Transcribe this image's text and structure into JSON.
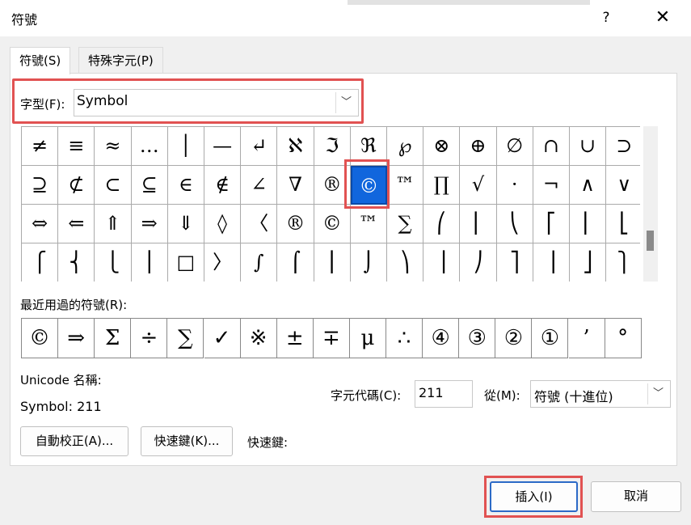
{
  "window": {
    "title": "符號",
    "help": "?",
    "close": "✕"
  },
  "tabs": [
    {
      "label": "符號(S)"
    },
    {
      "label": "特殊字元(P)"
    }
  ],
  "font": {
    "label": "字型(F):",
    "value": "Symbol"
  },
  "grid": {
    "rows": [
      [
        "≠",
        "≡",
        "≈",
        "…",
        "│",
        "—",
        "↵",
        "ℵ",
        "ℑ",
        "ℜ",
        "℘",
        "⊗",
        "⊕",
        "∅",
        "∩",
        "∪",
        "⊃"
      ],
      [
        "⊇",
        "⊄",
        "⊂",
        "⊆",
        "∈",
        "∉",
        "∠",
        "∇",
        "®",
        "©",
        "™",
        "∏",
        "√",
        "·",
        "¬",
        "∧",
        "∨"
      ],
      [
        "⇔",
        "⇐",
        "⇑",
        "⇒",
        "⇓",
        "◊",
        "〈",
        "®",
        "©",
        "™",
        "∑",
        "⎛",
        "⎜",
        "⎝",
        "⎡",
        "⎢",
        "⎣"
      ],
      [
        "⎧",
        "⎨",
        "⎩",
        "⎪",
        "□",
        "〉",
        "∫",
        "⌠",
        "⎮",
        "⌡",
        "⎞",
        "⎟",
        "⎠",
        "⎤",
        "⎥",
        "⎦",
        "⎫"
      ]
    ],
    "selected": {
      "row": 1,
      "col": 9
    }
  },
  "recent": {
    "label": "最近用過的符號(R):",
    "symbols": [
      "©",
      "⇒",
      "Σ",
      "÷",
      "∑",
      "✓",
      "※",
      "±",
      "∓",
      "μ",
      "∴",
      "④",
      "③",
      "②",
      "①",
      "’",
      "°"
    ]
  },
  "unicode": {
    "label": "Unicode 名稱:",
    "value": "Symbol: 211"
  },
  "char_code": {
    "label": "字元代碼(C):",
    "value": "211"
  },
  "from": {
    "label": "從(M):",
    "value": "符號 (十進位)"
  },
  "buttons": {
    "autocorrect": "自動校正(A)...",
    "shortcut_key": "快速鍵(K)...",
    "shortcut_label": "快速鍵:",
    "insert": "插入(I)",
    "cancel": "取消"
  }
}
